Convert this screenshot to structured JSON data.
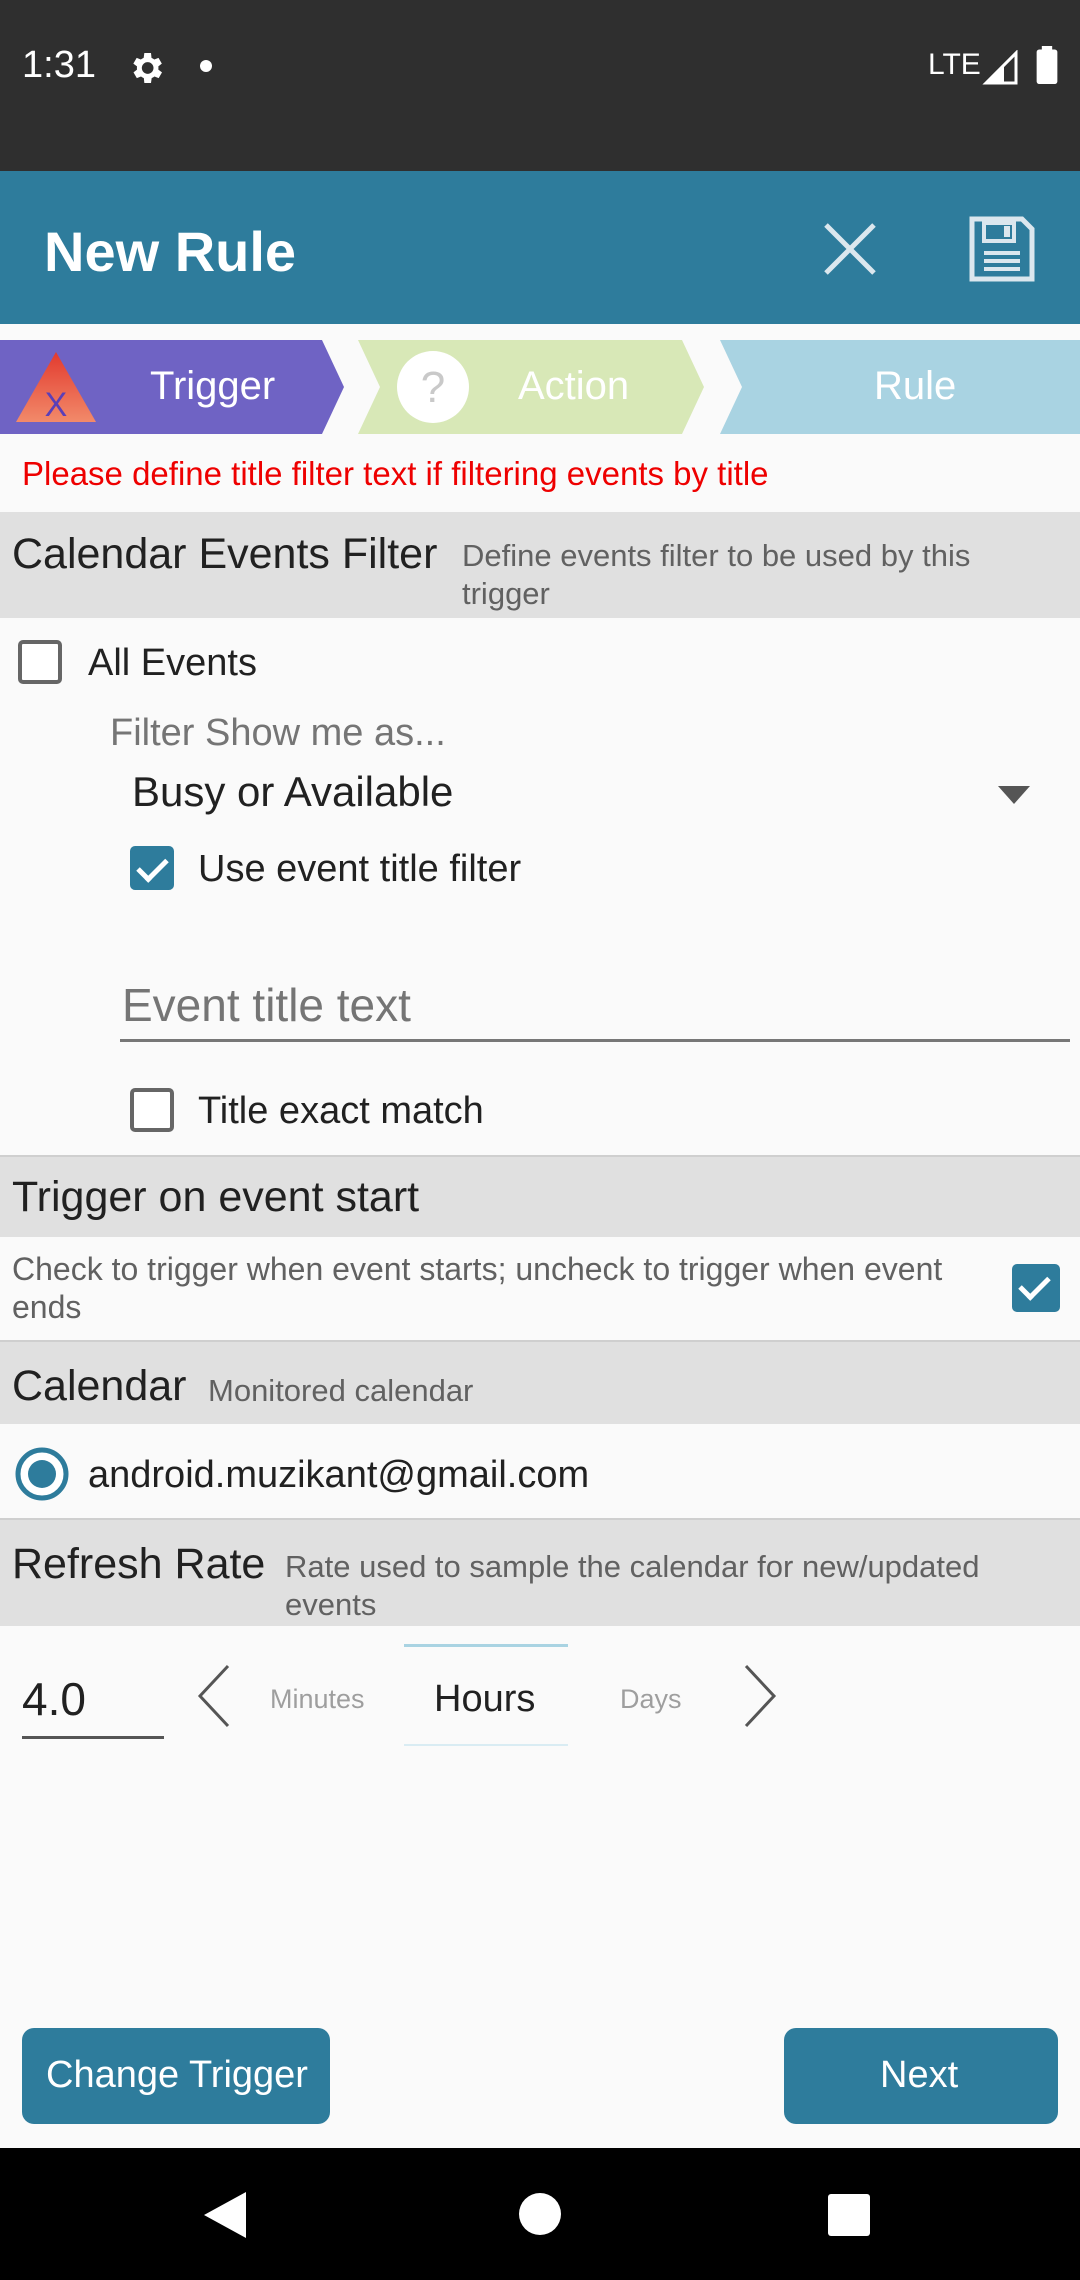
{
  "status_bar": {
    "time": "1:31",
    "network": "LTE",
    "icons": [
      "gear-icon",
      "dot-icon",
      "signal-icon",
      "battery-icon"
    ]
  },
  "app_bar": {
    "title": "New Rule",
    "icons": [
      "close-icon",
      "save-icon"
    ]
  },
  "steps": [
    {
      "label": "Trigger",
      "color": "#6f63c4",
      "icon": "trigger-warning-icon"
    },
    {
      "label": "Action",
      "color": "#d8e8b7",
      "icon": "question-icon"
    },
    {
      "label": "Rule",
      "color": "#a9d3e2"
    }
  ],
  "warning": "Please define title filter text if filtering events by title",
  "filter_section": {
    "title": "Calendar Events Filter",
    "description": "Define events filter to be used by this trigger",
    "all_events": {
      "label": "All Events",
      "checked": false
    },
    "show_me_as_label": "Filter Show me as...",
    "show_me_as_value": "Busy or Available",
    "use_title_filter": {
      "label": "Use event title filter",
      "checked": true
    },
    "title_placeholder": "Event title text",
    "exact_match": {
      "label": "Title exact match",
      "checked": false
    }
  },
  "trigger_start": {
    "title": "Trigger on event start",
    "description": "Check to trigger when event starts; uncheck to trigger when event ends",
    "checked": true
  },
  "calendar": {
    "title": "Calendar",
    "description": "Monitored calendar",
    "account": "android.muzikant@gmail.com"
  },
  "refresh_rate": {
    "title": "Refresh Rate",
    "description": "Rate used to sample the calendar for new/updated events",
    "value": "4.0",
    "units": [
      "Minutes",
      "Hours",
      "Days"
    ],
    "selected_unit": "Hours"
  },
  "buttons": {
    "change_trigger": "Change Trigger",
    "next": "Next"
  },
  "colors": {
    "primary": "#2e7c9c",
    "warning": "#ee0000",
    "section_bg": "#e0e0e0"
  }
}
